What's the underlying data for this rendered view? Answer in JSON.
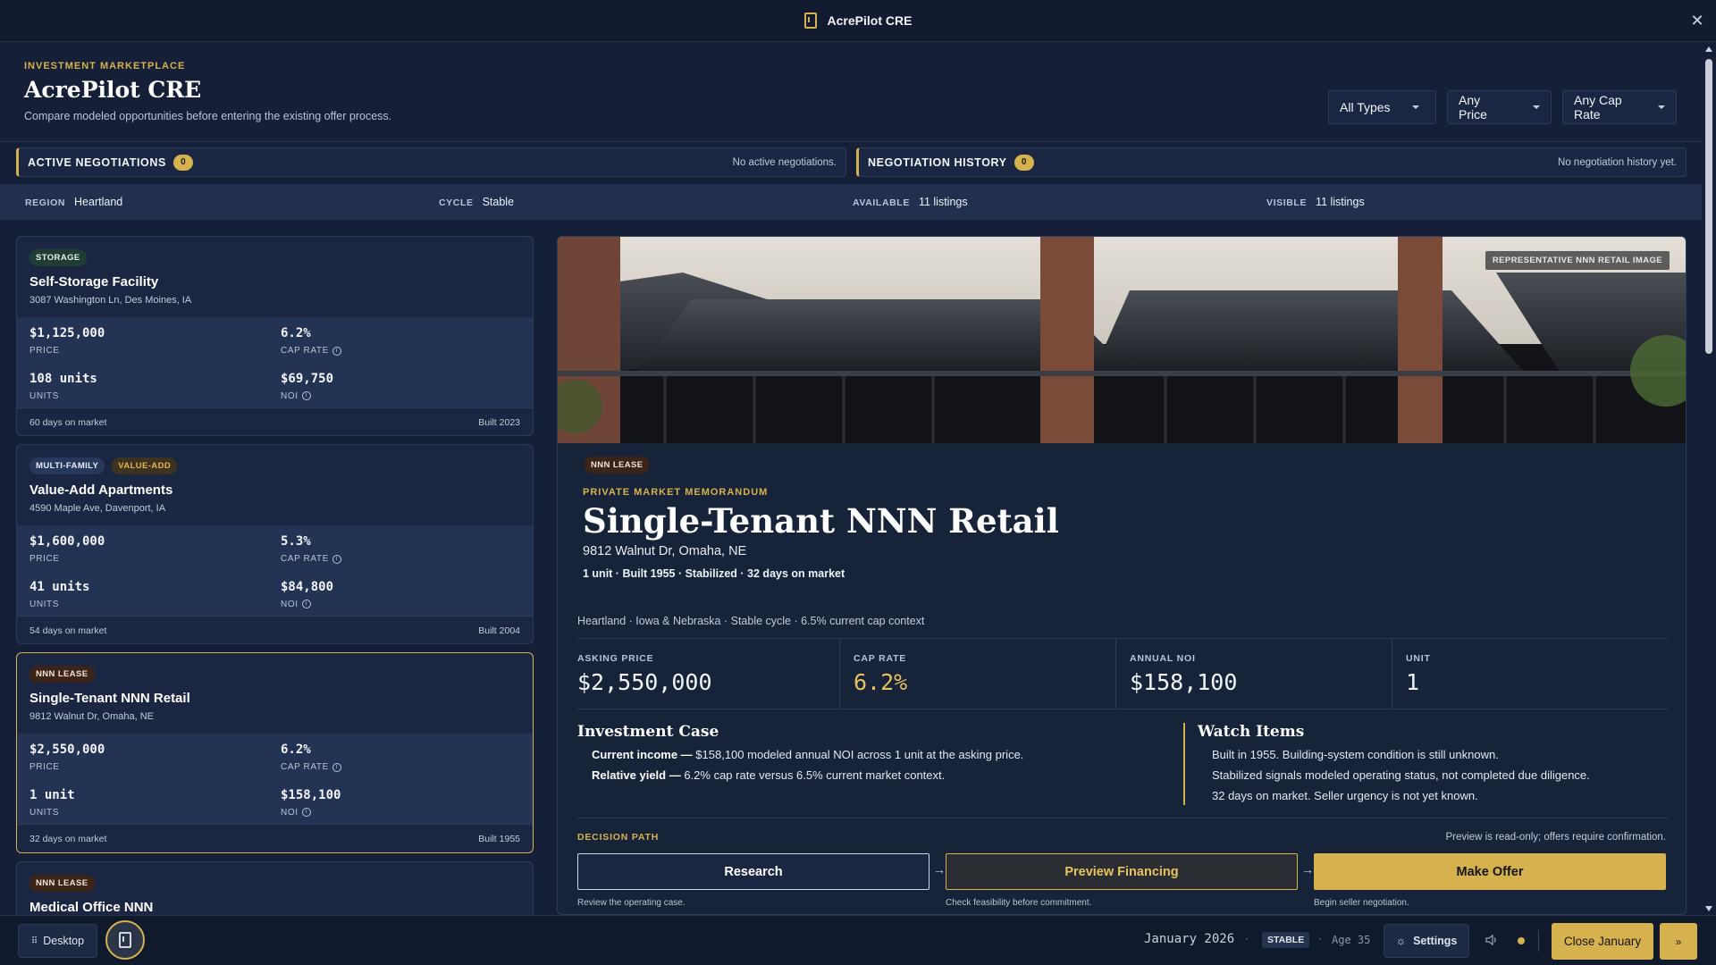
{
  "window": {
    "title": "AcrePilot CRE",
    "close_icon": "✕"
  },
  "header": {
    "eyebrow": "INVESTMENT MARKETPLACE",
    "title": "AcrePilot CRE",
    "subtitle": "Compare modeled opportunities before entering the existing offer process.",
    "filters": [
      "All Types",
      "Any Price",
      "Any Cap Rate"
    ]
  },
  "negotiations": {
    "active": {
      "label": "ACTIVE NEGOTIATIONS",
      "count": "0",
      "message": "No active negotiations."
    },
    "history": {
      "label": "NEGOTIATION HISTORY",
      "count": "0",
      "message": "No negotiation history yet."
    }
  },
  "stats": [
    {
      "key": "REGION",
      "value": "Heartland"
    },
    {
      "key": "CYCLE",
      "value": "Stable"
    },
    {
      "key": "AVAILABLE",
      "value": "11 listings"
    },
    {
      "key": "VISIBLE",
      "value": "11 listings"
    }
  ],
  "metric_labels": {
    "price": "PRICE",
    "cap": "CAP RATE",
    "units": "UNITS",
    "noi": "NOI"
  },
  "listings": [
    {
      "tags": [
        "STORAGE"
      ],
      "name": "Self-Storage Facility",
      "address": "3087 Washington Ln, Des Moines, IA",
      "price": "$1,125,000",
      "cap": "6.2%",
      "units": "108 units",
      "noi": "$69,750",
      "days": "60 days on market",
      "built": "Built 2023"
    },
    {
      "tags": [
        "MULTI-FAMILY",
        "VALUE-ADD"
      ],
      "name": "Value-Add Apartments",
      "address": "4590 Maple Ave, Davenport, IA",
      "price": "$1,600,000",
      "cap": "5.3%",
      "units": "41 units",
      "noi": "$84,800",
      "days": "54 days on market",
      "built": "Built 2004"
    },
    {
      "tags": [
        "NNN LEASE"
      ],
      "name": "Single-Tenant NNN Retail",
      "address": "9812 Walnut Dr, Omaha, NE",
      "price": "$2,550,000",
      "cap": "6.2%",
      "units": "1 unit",
      "noi": "$158,100",
      "days": "32 days on market",
      "built": "Built 1955",
      "selected": true
    },
    {
      "tags": [
        "NNN LEASE"
      ],
      "name": "Medical Office NNN"
    }
  ],
  "detail": {
    "image_badge": "REPRESENTATIVE NNN RETAIL IMAGE",
    "tag": "NNN LEASE",
    "eyebrow": "PRIVATE MARKET MEMORANDUM",
    "title": "Single-Tenant NNN Retail",
    "address": "9812 Walnut Dr, Omaha, NE",
    "meta": "1 unit · Built 1955 · Stabilized · 32 days on market",
    "context": "Heartland · Iowa & Nebraska · Stable cycle · 6.5% current cap context",
    "kpis": [
      {
        "key": "ASKING PRICE",
        "value": "$2,550,000"
      },
      {
        "key": "CAP RATE",
        "value": "6.2%"
      },
      {
        "key": "ANNUAL NOI",
        "value": "$158,100"
      },
      {
        "key": "UNIT",
        "value": "1"
      }
    ],
    "investment_case": {
      "heading": "Investment Case",
      "items": [
        {
          "bold": "Current income —",
          "text": " $158,100 modeled annual NOI across 1 unit at the asking price."
        },
        {
          "bold": "Relative yield —",
          "text": " 6.2% cap rate versus 6.5% current market context."
        }
      ]
    },
    "watch_items": {
      "heading": "Watch Items",
      "items": [
        "Built in 1955. Building-system condition is still unknown.",
        "Stabilized signals modeled operating status, not completed due diligence.",
        "32 days on market. Seller urgency is not yet known."
      ]
    },
    "decision_path": {
      "label": "DECISION PATH",
      "note": "Preview is read-only; offers require confirmation.",
      "steps": [
        {
          "label": "Research",
          "sub": "Review the operating case."
        },
        {
          "label": "Preview Financing",
          "sub": "Check feasibility before commitment."
        },
        {
          "label": "Make Offer",
          "sub": "Begin seller negotiation."
        }
      ]
    }
  },
  "bottombar": {
    "desktop": "Desktop",
    "date": "January 2026",
    "cycle": "STABLE",
    "age": "Age 35",
    "settings": "Settings",
    "close_month": "Close January",
    "fast_forward": "»"
  },
  "colors": {
    "accent": "#d6b24e",
    "background": "#152038",
    "panel": "#1b2742"
  }
}
